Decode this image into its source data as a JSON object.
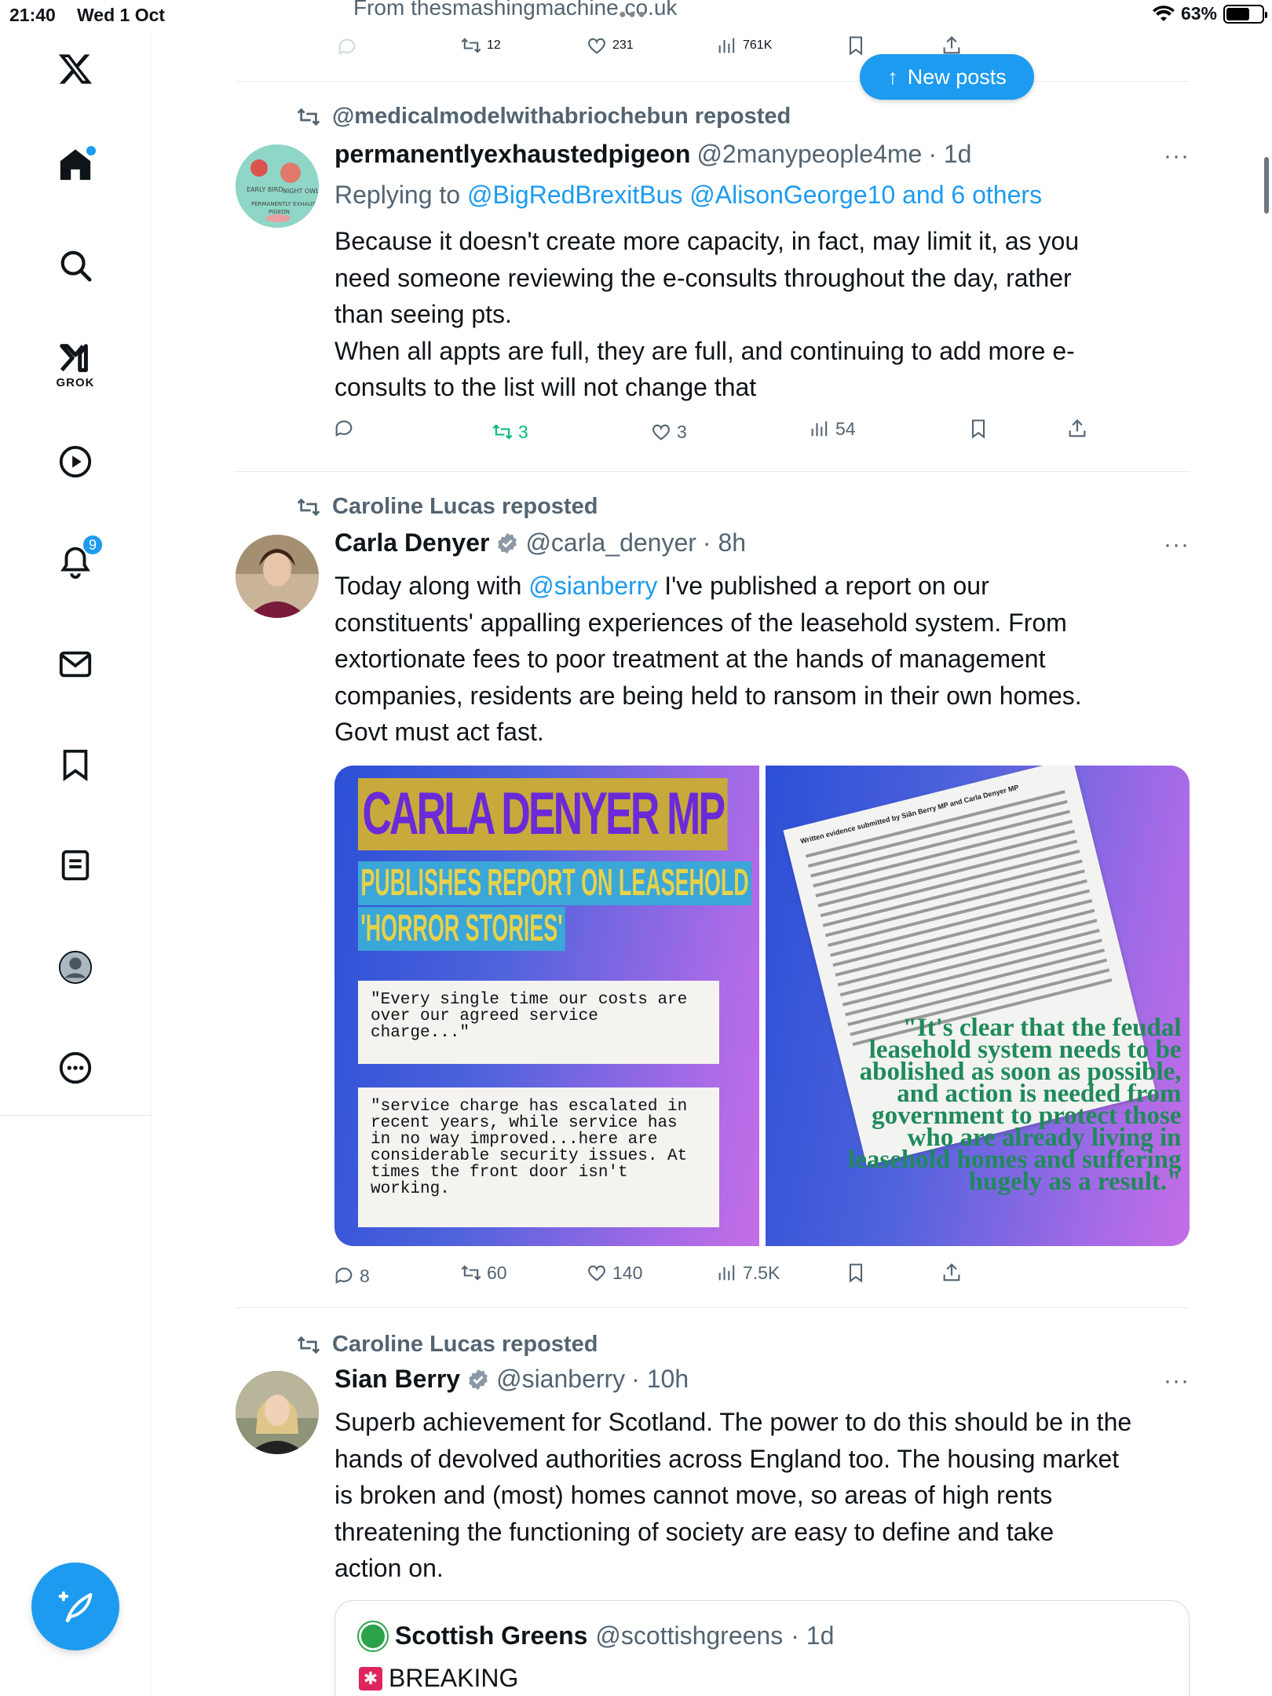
{
  "status_bar": {
    "time": "21:40",
    "date": "Wed 1 Oct",
    "battery": "63%"
  },
  "sidebar": {
    "grok_label": "GROK",
    "notifications_count": "9"
  },
  "top_fragment": {
    "source": "From thesmashingmachine.co.uk",
    "retweets": "12",
    "likes": "231",
    "views": "761K"
  },
  "new_posts_label": "New posts",
  "posts": [
    {
      "reposted_by": "@medicalmodelwithabriochebun reposted",
      "name": "permanentlyexhaustedpigeon",
      "handle": "@2manypeople4me",
      "time": "· 1d",
      "replying_prefix": "Replying to",
      "replying_to": "@BigRedBrexitBus @AlisonGeorge10 and 6 others",
      "body_lines": [
        "Because it doesn't create more capacity, in fact, may limit it, as you",
        "need someone reviewing the e-consults throughout the day, rather",
        "than seeing pts.",
        "When all appts are full, they are full, and continuing to add more e-",
        "consults to the list will not change that"
      ],
      "replies": "",
      "retweets": "3",
      "likes": "3",
      "views": "54"
    },
    {
      "reposted_by": "Caroline Lucas reposted",
      "name": "Carla Denyer",
      "handle": "@carla_denyer",
      "time": "· 8h",
      "body_prefix": "Today along with ",
      "body_mention": "@sianberry",
      "body_line1_rest": " I've published a report on our",
      "body_lines": [
        "constituents' appalling experiences of the leasehold system. From",
        "extortionate fees to poor treatment at the hands of management",
        "companies, residents are being held to ransom in their own homes.",
        "Govt must act fast."
      ],
      "image_left": {
        "title": "CARLA DENYER MP",
        "subtitle1": "PUBLISHES REPORT ON LEASEHOLD",
        "subtitle2": "'HORROR STORIES'",
        "quote1": "\"Every single time our costs are over our agreed service charge...\"",
        "quote2": "\"service charge has escalated in recent years, while service has in no way improved...here are considerable security issues. At times the front door isn't working."
      },
      "image_right": {
        "doc_heading": "Written evidence submitted by Siân Berry MP and Carla Denyer MP",
        "quote": "\"It's clear that the feudal leasehold system needs to be abolished as soon as possible, and action is needed from government to protect those who are already living in leasehold homes and suffering hugely as a result.\""
      },
      "replies": "8",
      "retweets": "60",
      "likes": "140",
      "views": "7.5K"
    },
    {
      "reposted_by": "Caroline Lucas reposted",
      "name": "Sian Berry",
      "handle": "@sianberry",
      "time": "· 10h",
      "body_lines": [
        "Superb achievement for Scotland. The power to do this should be in the",
        "hands of devolved authorities across England too. The housing market",
        "is broken and (most) homes cannot move, so areas of high rents",
        "threatening the functioning of society are easy to define and take",
        "action on."
      ],
      "quoted": {
        "name": "Scottish Greens",
        "handle": "@scottishgreens",
        "time": "· 1d",
        "text": "BREAKING"
      }
    }
  ],
  "colors": {
    "accent": "#1d9bf0",
    "retweet_active": "#00ba7c",
    "muted": "#536471"
  }
}
